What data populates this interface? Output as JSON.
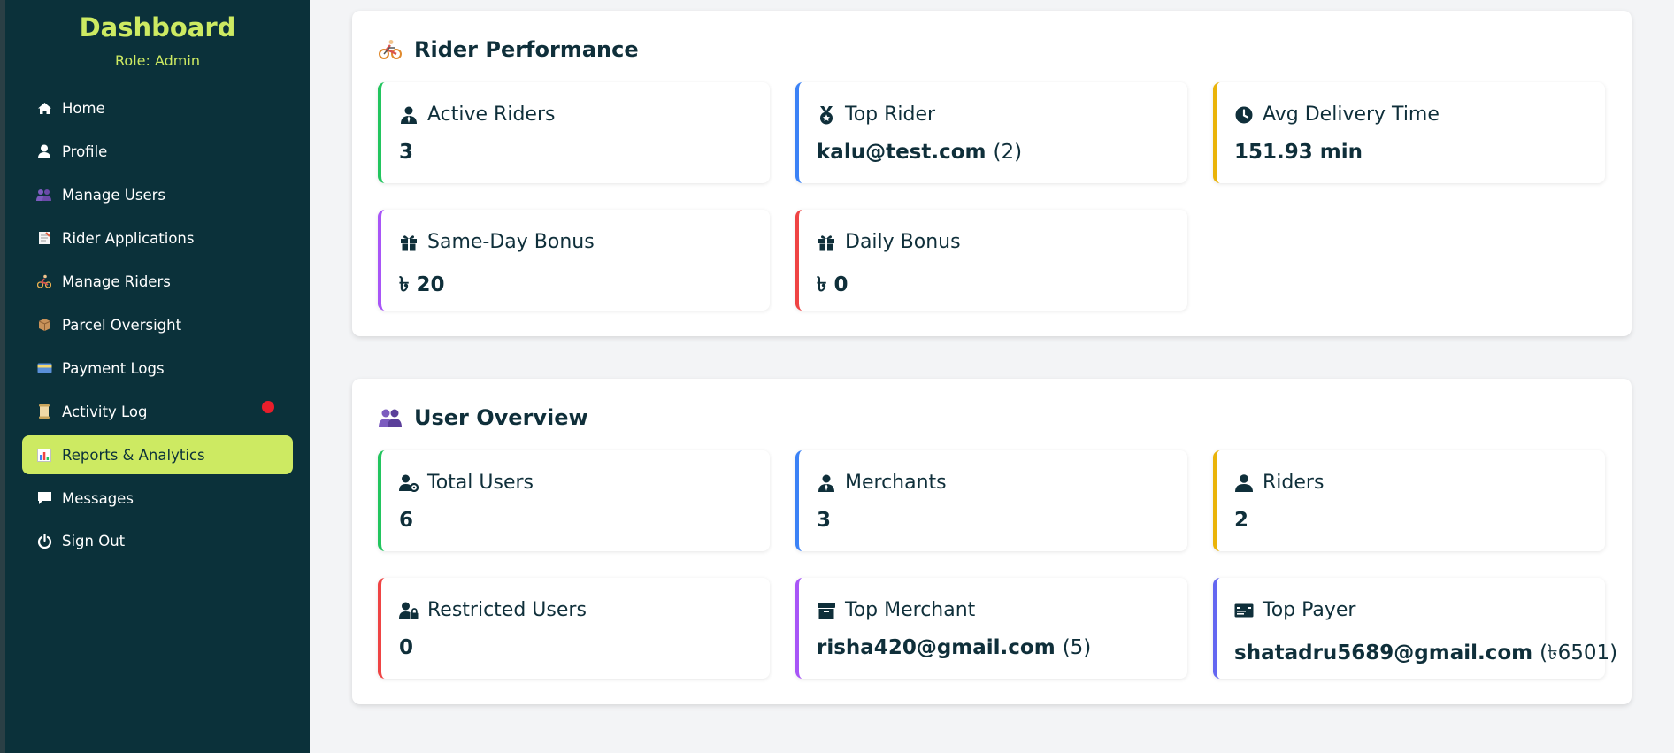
{
  "sidebar": {
    "title": "Dashboard",
    "role": "Role: Admin",
    "items": [
      {
        "label": "Home",
        "icon": "home-icon"
      },
      {
        "label": "Profile",
        "icon": "user-icon"
      },
      {
        "label": "Manage Users",
        "icon": "users-emoji-icon"
      },
      {
        "label": "Rider Applications",
        "icon": "memo-icon"
      },
      {
        "label": "Manage Riders",
        "icon": "cyclist-icon"
      },
      {
        "label": "Parcel Oversight",
        "icon": "package-icon"
      },
      {
        "label": "Payment Logs",
        "icon": "credit-card-icon"
      },
      {
        "label": "Activity Log",
        "icon": "scroll-icon"
      },
      {
        "label": "Reports & Analytics",
        "icon": "bar-chart-icon"
      },
      {
        "label": "Messages",
        "icon": "message-icon"
      },
      {
        "label": "Sign Out",
        "icon": "power-icon"
      }
    ],
    "active_item": "Reports & Analytics",
    "notification_item": "Activity Log"
  },
  "rider_performance": {
    "title": "Rider Performance",
    "cards": {
      "active_riders": {
        "label": "Active Riders",
        "value": "3"
      },
      "top_rider": {
        "label": "Top Rider",
        "value": "kalu@test.com",
        "extra": "(2)"
      },
      "avg_delivery": {
        "label": "Avg Delivery Time",
        "value": "151.93 min"
      },
      "same_day_bonus": {
        "label": "Same-Day Bonus",
        "value": "৳ 20"
      },
      "daily_bonus": {
        "label": "Daily Bonus",
        "value": "৳ 0"
      }
    }
  },
  "user_overview": {
    "title": "User Overview",
    "cards": {
      "total_users": {
        "label": "Total Users",
        "value": "6"
      },
      "merchants": {
        "label": "Merchants",
        "value": "3"
      },
      "riders": {
        "label": "Riders",
        "value": "2"
      },
      "restricted_users": {
        "label": "Restricted Users",
        "value": "0"
      },
      "top_merchant": {
        "label": "Top Merchant",
        "value": "risha420@gmail.com",
        "extra": "(5)"
      },
      "top_payer": {
        "label": "Top Payer",
        "value": "shatadru5689@gmail.com",
        "extra": "(৳6501)"
      }
    }
  },
  "colors": {
    "sidebar_bg": "#0b313a",
    "accent": "#cdea62",
    "text_dark": "#0f2f3a",
    "green": "#22c55e",
    "blue": "#3b82f6",
    "yellow": "#eab308",
    "purple": "#a855f7",
    "red": "#ef4444",
    "indigo": "#6366f1"
  }
}
